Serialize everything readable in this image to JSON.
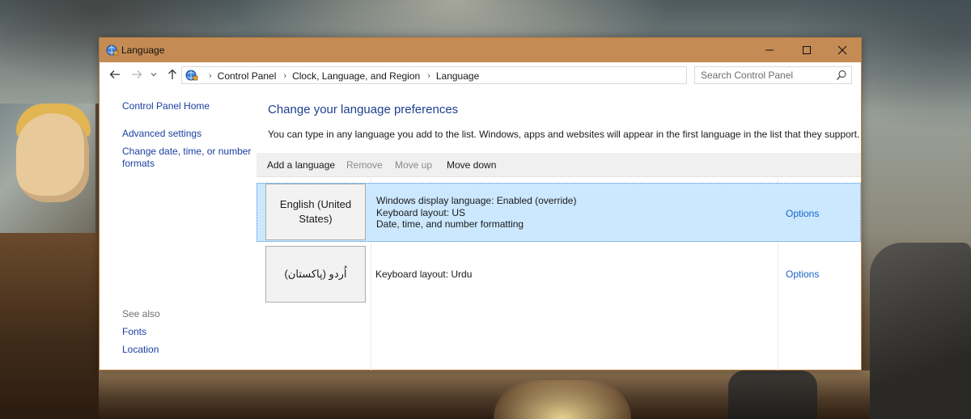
{
  "window": {
    "title": "Language",
    "colors": {
      "titlebar": "#c58b54",
      "link": "#1a3fa0",
      "heading": "#1e3f8f",
      "selection": "#cce8ff"
    }
  },
  "address": {
    "crumbs": [
      "Control Panel",
      "Clock, Language, and Region",
      "Language"
    ]
  },
  "search": {
    "placeholder": "Search Control Panel"
  },
  "sidebar": {
    "home": "Control Panel Home",
    "advanced": "Advanced settings",
    "date_formats": "Change date, time, or number formats",
    "see_also": "See also",
    "fonts": "Fonts",
    "location": "Location"
  },
  "main": {
    "title": "Change your language preferences",
    "description": "You can type in any language you add to the list. Windows, apps and websites will appear in the first language in the list that they support."
  },
  "toolbar": {
    "add": "Add a language",
    "remove": "Remove",
    "move_up": "Move up",
    "move_down": "Move down"
  },
  "languages": [
    {
      "name": "English (United States)",
      "details": [
        "Windows display language: Enabled (override)",
        "Keyboard layout: US",
        "Date, time, and number formatting"
      ],
      "options": "Options",
      "selected": true
    },
    {
      "name": "اُردو (پاکستان)",
      "details": [
        "Keyboard layout: Urdu"
      ],
      "options": "Options",
      "selected": false
    }
  ]
}
